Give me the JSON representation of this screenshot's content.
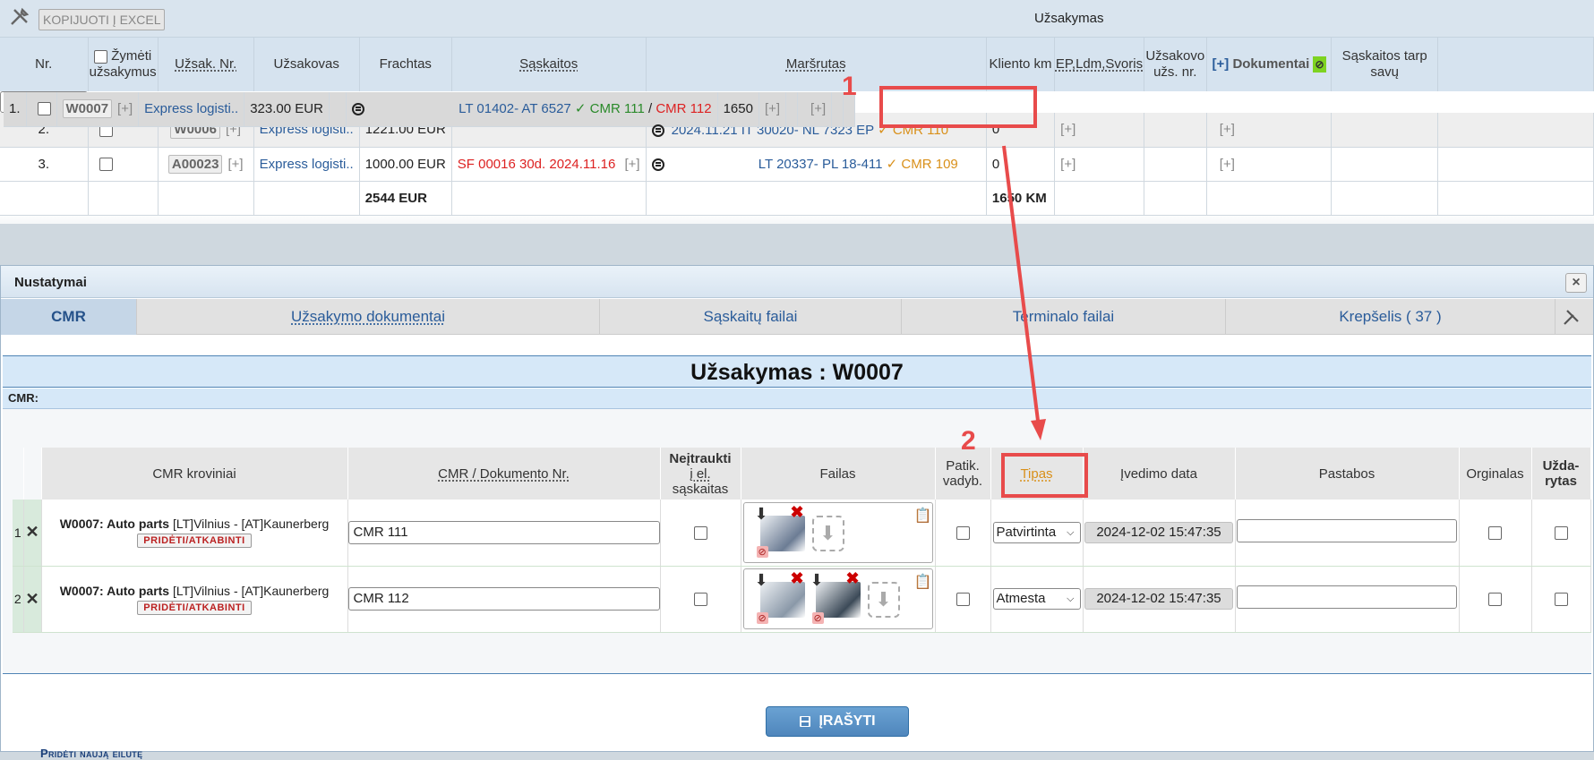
{
  "toolbar": {
    "excel_label": "KOPIJUOTI Į EXCEL",
    "title": "Užsakymas"
  },
  "grid": {
    "headers": {
      "nr": "Nr.",
      "mark_line1": "Žymėti",
      "mark_line2": "užsakymus",
      "order_no": "Užsak. Nr.",
      "client": "Užsakovas",
      "freight": "Frachtas",
      "invoices": "Sąskaitos",
      "route": "Maršrutas",
      "client_km": "Kliento km",
      "ep": "EP,Ldm,Svoris",
      "client_no_line1": "Užsakovo",
      "client_no_line2": "užs. nr.",
      "docs_plus": "[+]",
      "docs": "Dokumentai",
      "between": "Sąskaitos tarp savų"
    },
    "rows": [
      {
        "nr": "1.",
        "order": "W0007",
        "plus": "[+]",
        "client": "Express logisti..",
        "freight": "323.00 EUR",
        "invoice": "",
        "inv_plus": "",
        "date": "",
        "route": "LT 01402- AT 6527",
        "cmr1": "✓ CMR 111",
        "sep": "/",
        "cmr2": "CMR 112",
        "km": "1650",
        "ep": "[+]",
        "doc": "[+]"
      },
      {
        "nr": "2.",
        "order": "W0006",
        "plus": "[+]",
        "client": "Express logisti..",
        "freight": "1221.00 EUR",
        "invoice": "",
        "inv_plus": "",
        "date": "2024.11.21",
        "route": "IT 30020- NL 7323 EP",
        "cmr1": "✓ CMR 110",
        "sep": "",
        "cmr2": "",
        "km": "0",
        "ep": "[+]",
        "doc": "[+]"
      },
      {
        "nr": "3.",
        "order": "A00023",
        "plus": "[+]",
        "client": "Express logisti..",
        "freight": "1000.00 EUR",
        "invoice": "SF 00016 30d. 2024.11.16",
        "inv_plus": "[+]",
        "date": "",
        "route": "LT 20337- PL 18-411",
        "cmr1": "✓ CMR 109",
        "sep": "",
        "cmr2": "",
        "km": "0",
        "ep": "[+]",
        "doc": "[+]"
      }
    ],
    "totals": {
      "freight": "2544 EUR",
      "km": "1650 KM"
    }
  },
  "dialog": {
    "title": "Nustatymai",
    "close": "×",
    "tabs": [
      "CMR",
      "Užsakymo dokumentai",
      "Sąskaitų failai",
      "Terminalo failai",
      "Krepšelis ( 37 )"
    ],
    "order_title": "Užsakymas : W0007",
    "cmr_label": "CMR:",
    "table_headers": {
      "cargo": "CMR kroviniai",
      "doc_no": "CMR / Dokumento Nr.",
      "exclude_l1": "Neįtraukti",
      "exclude_l2": "į el.",
      "exclude_l3": "sąskaitas",
      "file": "Failas",
      "checked_l1": "Patik.",
      "checked_l2": "vadyb.",
      "type": "Tipas",
      "date": "Įvedimo data",
      "notes": "Pastabos",
      "original": "Orginalas",
      "closed_l1": "Užda-",
      "closed_l2": "rytas"
    },
    "rows": [
      {
        "n": "1",
        "code": "W0007",
        "title": "Auto parts",
        "route": "[LT]Vilnius - [AT]Kaunerberg",
        "attach": "PRIDĖTI/ATKABINTI",
        "doc": "CMR 111",
        "type": "Patvirtinta",
        "date": "2024-12-02 15:47:35"
      },
      {
        "n": "2",
        "code": "W0007",
        "title": "Auto parts",
        "route": "[LT]Vilnius - [AT]Kaunerberg",
        "attach": "PRIDĖTI/ATKABINTI",
        "doc": "CMR 112",
        "type": "Atmesta",
        "date": "2024-12-02 15:47:35"
      }
    ],
    "add_row": "Pridėti naują eilutę",
    "save": "ĮRAŠYTI"
  },
  "annotations": {
    "n1": "1",
    "n2": "2",
    "color": "#e84b4b"
  }
}
